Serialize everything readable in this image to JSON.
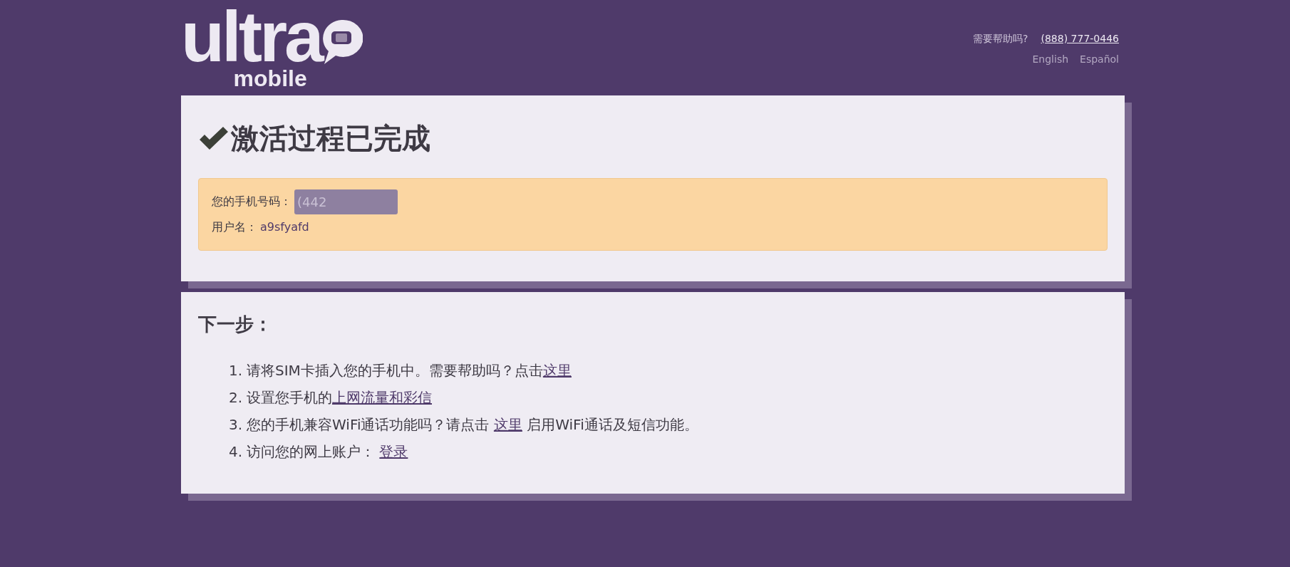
{
  "logo": {
    "word": "ultra",
    "subword": "mobile"
  },
  "header": {
    "help_text": "需要帮助吗?",
    "phone": "(888) 777-0446",
    "languages": [
      "English",
      "Español"
    ]
  },
  "status_card": {
    "title": "激活过程已完成",
    "fields": [
      {
        "label": "您的手机号码：",
        "value": "(442",
        "redacted": true
      },
      {
        "label": "用户名：",
        "value": "a9sfyafd",
        "redacted": false
      }
    ]
  },
  "next_steps": {
    "title": "下一步：",
    "steps": [
      {
        "number": "1.",
        "parts": [
          {
            "kind": "text",
            "text": "请将SIM卡插入您的手机中。需要帮助吗？点击"
          },
          {
            "kind": "link",
            "text": "这里"
          }
        ]
      },
      {
        "number": "2.",
        "parts": [
          {
            "kind": "text",
            "text": "设置您手机的"
          },
          {
            "kind": "link",
            "text": "上网流量和彩信"
          }
        ]
      },
      {
        "number": "3.",
        "parts": [
          {
            "kind": "text",
            "text": "您的手机兼容WiFi通话功能吗？请点击 "
          },
          {
            "kind": "link",
            "text": "这里"
          },
          {
            "kind": "text",
            "text": " 启用WiFi通话及短信功能。"
          }
        ]
      },
      {
        "number": "4.",
        "parts": [
          {
            "kind": "text",
            "text": "访问您的网上账户： "
          },
          {
            "kind": "link",
            "text": "登录"
          }
        ]
      }
    ]
  }
}
